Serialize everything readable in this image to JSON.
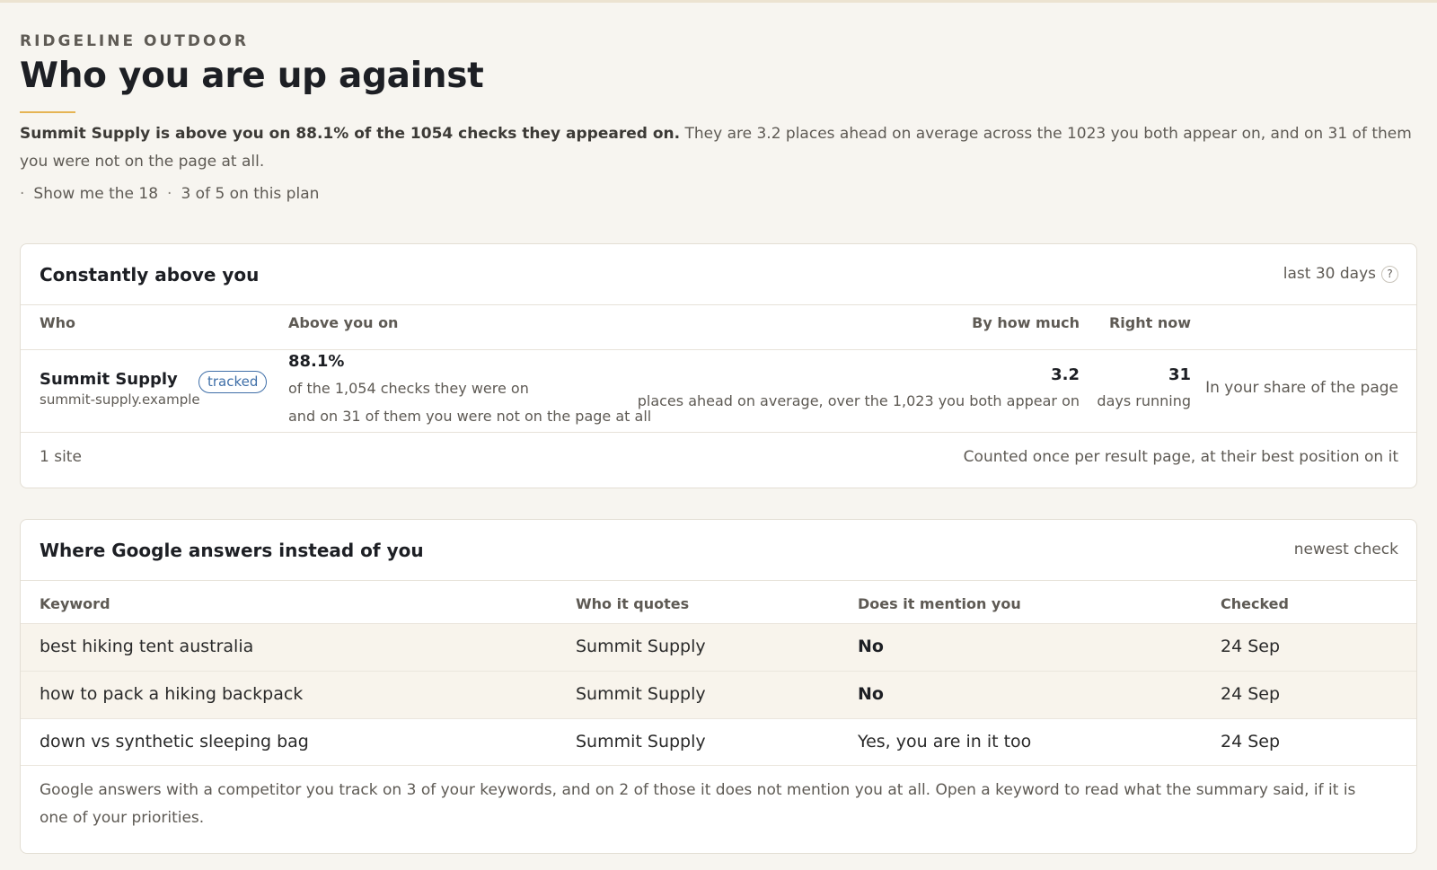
{
  "brand": "RIDGELINE OUTDOOR",
  "title": "Who you are up against",
  "summary": {
    "lead": "Summit Supply is above you on 88.1% of the 1054 checks they appeared on.",
    "rest": "They are 3.2 places ahead on average across the 1023 you both appear on, and on 31 of them you were not on the page at all."
  },
  "meta": {
    "show_link": "Show me the 18",
    "plan": "3 of 5 on this plan"
  },
  "constantly": {
    "title": "Constantly above you",
    "range": "last 30 days",
    "help": "?",
    "headers": {
      "who": "Who",
      "above": "Above you on",
      "by_how_much": "By how much",
      "right_now": "Right now"
    },
    "row": {
      "name": "Summit Supply",
      "domain": "summit-supply.example",
      "badge": "tracked",
      "above_pct": "88.1%",
      "above_detail": "of the 1,054 checks they were on",
      "above_detail2": "and on 31 of them you were not on the page at all",
      "ahead_value": "3.2",
      "ahead_detail": "places ahead on average, over the 1,023 you both appear on",
      "days_value": "31",
      "days_detail": "days running",
      "status": "In your share of the page"
    },
    "footer": {
      "count": "1 site",
      "note": "Counted once per result page, at their best position on it"
    }
  },
  "google": {
    "title": "Where Google answers instead of you",
    "range": "newest check",
    "headers": {
      "keyword": "Keyword",
      "quotes": "Who it quotes",
      "mention": "Does it mention you",
      "checked": "Checked"
    },
    "rows": [
      {
        "keyword": "best hiking tent australia",
        "quotes": "Summit Supply",
        "mention": "No",
        "checked": "24 Sep"
      },
      {
        "keyword": "how to pack a hiking backpack",
        "quotes": "Summit Supply",
        "mention": "No",
        "checked": "24 Sep"
      },
      {
        "keyword": "down vs synthetic sleeping bag",
        "quotes": "Summit Supply",
        "mention": "Yes, you are in it too",
        "checked": "24 Sep"
      }
    ],
    "footnote": "Google answers with a competitor you track on 3 of your keywords, and on 2 of those it does not mention you at all. Open a keyword to read what the summary said, if it is one of your priorities."
  }
}
